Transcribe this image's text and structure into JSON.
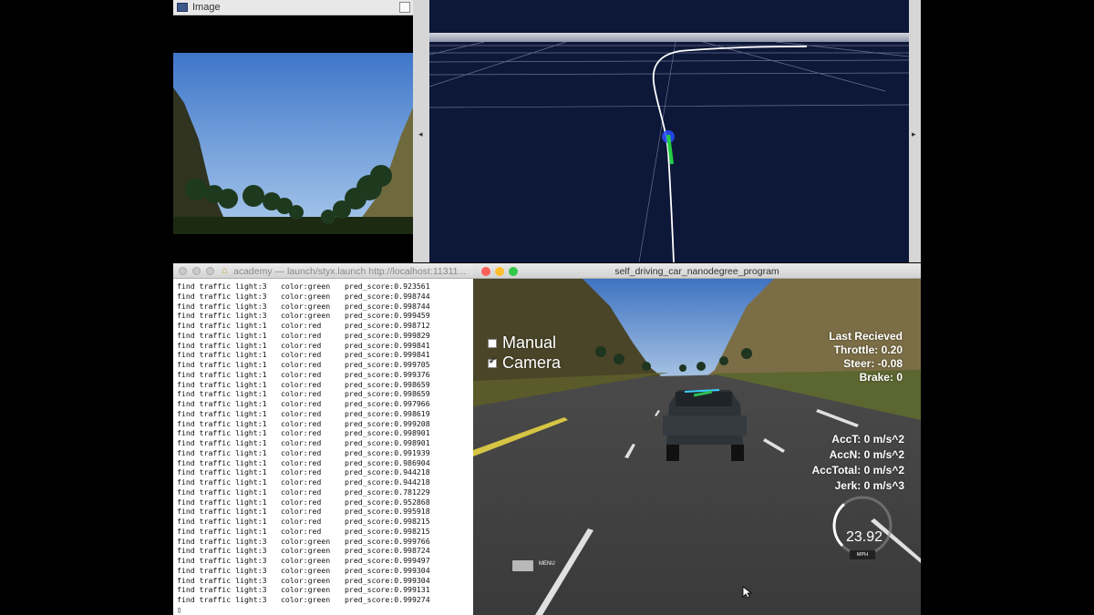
{
  "image_window": {
    "title": "Image",
    "icons": {
      "app": "image-app-icon",
      "maximize": "maximize-icon"
    }
  },
  "rviz": {
    "arrow_left": "◂",
    "arrow_right": "▸",
    "colors": {
      "background": "#0d1738",
      "path": "#ffffff",
      "vehicle": "#2a4cff",
      "waypoints": "#22cc44"
    }
  },
  "terminal": {
    "title": "academy — launch/styx.launch http://localhost:11311...",
    "icons": {
      "home": "home-icon"
    },
    "lines": [
      {
        "find": "find traffic light:3",
        "color": "color:green",
        "score": "pred_score:0.923561"
      },
      {
        "find": "find traffic light:3",
        "color": "color:green",
        "score": "pred_score:0.998744"
      },
      {
        "find": "find traffic light:3",
        "color": "color:green",
        "score": "pred_score:0.998744"
      },
      {
        "find": "find traffic light:3",
        "color": "color:green",
        "score": "pred_score:0.999459"
      },
      {
        "find": "find traffic light:1",
        "color": "color:red",
        "score": "pred_score:0.998712"
      },
      {
        "find": "find traffic light:1",
        "color": "color:red",
        "score": "pred_score:0.999829"
      },
      {
        "find": "find traffic light:1",
        "color": "color:red",
        "score": "pred_score:0.999841"
      },
      {
        "find": "find traffic light:1",
        "color": "color:red",
        "score": "pred_score:0.999841"
      },
      {
        "find": "find traffic light:1",
        "color": "color:red",
        "score": "pred_score:0.999705"
      },
      {
        "find": "find traffic light:1",
        "color": "color:red",
        "score": "pred_score:0.999376"
      },
      {
        "find": "find traffic light:1",
        "color": "color:red",
        "score": "pred_score:0.998659"
      },
      {
        "find": "find traffic light:1",
        "color": "color:red",
        "score": "pred_score:0.998659"
      },
      {
        "find": "find traffic light:1",
        "color": "color:red",
        "score": "pred_score:0.997966"
      },
      {
        "find": "find traffic light:1",
        "color": "color:red",
        "score": "pred_score:0.998619"
      },
      {
        "find": "find traffic light:1",
        "color": "color:red",
        "score": "pred_score:0.999208"
      },
      {
        "find": "find traffic light:1",
        "color": "color:red",
        "score": "pred_score:0.998901"
      },
      {
        "find": "find traffic light:1",
        "color": "color:red",
        "score": "pred_score:0.998901"
      },
      {
        "find": "find traffic light:1",
        "color": "color:red",
        "score": "pred_score:0.991939"
      },
      {
        "find": "find traffic light:1",
        "color": "color:red",
        "score": "pred_score:0.986904"
      },
      {
        "find": "find traffic light:1",
        "color": "color:red",
        "score": "pred_score:0.944218"
      },
      {
        "find": "find traffic light:1",
        "color": "color:red",
        "score": "pred_score:0.944218"
      },
      {
        "find": "find traffic light:1",
        "color": "color:red",
        "score": "pred_score:0.781229"
      },
      {
        "find": "find traffic light:1",
        "color": "color:red",
        "score": "pred_score:0.952868"
      },
      {
        "find": "find traffic light:1",
        "color": "color:red",
        "score": "pred_score:0.995918"
      },
      {
        "find": "find traffic light:1",
        "color": "color:red",
        "score": "pred_score:0.998215"
      },
      {
        "find": "find traffic light:1",
        "color": "color:red",
        "score": "pred_score:0.998215"
      },
      {
        "find": "find traffic light:3",
        "color": "color:green",
        "score": "pred_score:0.999766"
      },
      {
        "find": "find traffic light:3",
        "color": "color:green",
        "score": "pred_score:0.998724"
      },
      {
        "find": "find traffic light:3",
        "color": "color:green",
        "score": "pred_score:0.999497"
      },
      {
        "find": "find traffic light:3",
        "color": "color:green",
        "score": "pred_score:0.999304"
      },
      {
        "find": "find traffic light:3",
        "color": "color:green",
        "score": "pred_score:0.999304"
      },
      {
        "find": "find traffic light:3",
        "color": "color:green",
        "score": "pred_score:0.999131"
      },
      {
        "find": "find traffic light:3",
        "color": "color:green",
        "score": "pred_score:0.999274"
      }
    ],
    "prompt": "▯"
  },
  "simulator": {
    "title": "self_driving_car_nanodegree_program",
    "manual": {
      "label": "Manual",
      "checked": false
    },
    "camera": {
      "label": "Camera",
      "checked": true
    },
    "telemetry": {
      "header": "Last Recieved",
      "throttle": "Throttle: 0.20",
      "steer": "Steer: -0.08",
      "brake": "Brake: 0"
    },
    "accel": {
      "acct": "AccT: 0 m/s^2",
      "accn": "AccN: 0 m/s^2",
      "acctotal": "AccTotal: 0 m/s^2",
      "jerk": "Jerk: 0 m/s^3"
    },
    "speedometer": {
      "value": "23.92",
      "unit": "MPH",
      "fraction": 0.35
    },
    "menu_label": "MENU",
    "icons": {
      "cursor": "mouse-cursor-icon"
    }
  }
}
